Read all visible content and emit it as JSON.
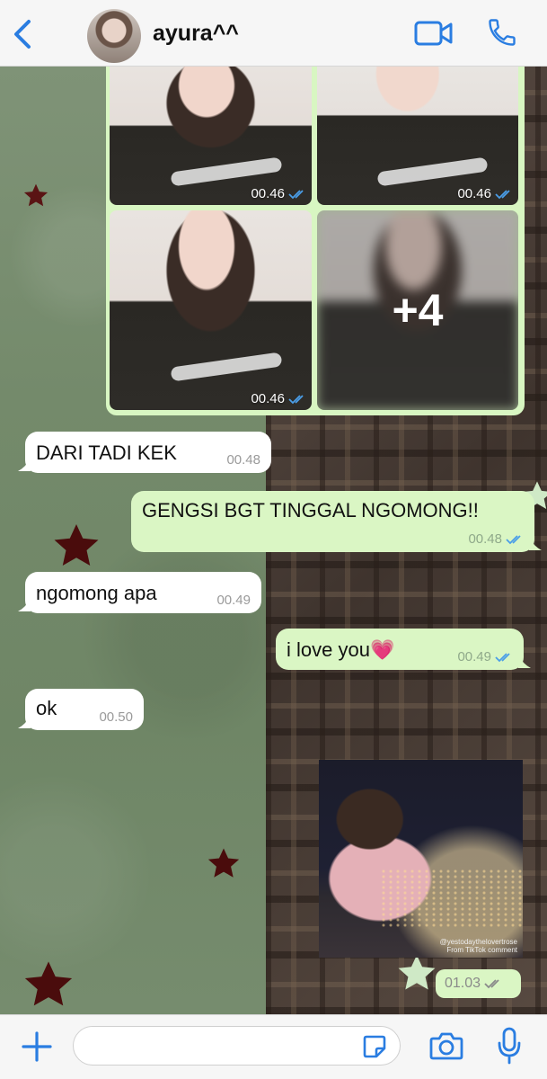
{
  "header": {
    "contact_name": "ayura^^",
    "back_icon": "chevron-left-icon",
    "video_call_icon": "video-camera-icon",
    "voice_call_icon": "phone-icon"
  },
  "photo_album": {
    "photos": [
      {
        "time": "00.46",
        "status": "read"
      },
      {
        "time": "00.46",
        "status": "read"
      },
      {
        "time": "00.46",
        "status": "read"
      },
      {
        "more_count": "+4"
      }
    ]
  },
  "messages": [
    {
      "direction": "incoming",
      "text": "DARI TADI KEK",
      "time": "00.48"
    },
    {
      "direction": "outgoing",
      "text": "GENGSI BGT TINGGAL NGOMONG!!",
      "time": "00.48",
      "status": "read"
    },
    {
      "direction": "incoming",
      "text": "ngomong apa",
      "time": "00.49"
    },
    {
      "direction": "outgoing",
      "text": "i love you💗",
      "time": "00.49",
      "status": "read"
    },
    {
      "direction": "incoming",
      "text": "ok",
      "time": "00.50"
    }
  ],
  "video_message": {
    "caption": "@yestodaythelovertrose\nFrom TikTok comment",
    "time": "01.03",
    "status": "delivered"
  },
  "composer": {
    "input_value": "",
    "input_placeholder": ""
  },
  "colors": {
    "accent": "#2a7de1",
    "outgoing_bubble": "#daf6c4",
    "incoming_bubble": "#ffffff",
    "read_check": "#4a9ee8"
  }
}
